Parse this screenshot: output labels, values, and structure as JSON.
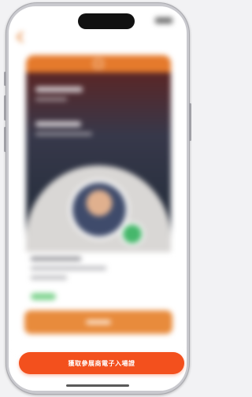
{
  "screen": {
    "primary_action": {
      "label": "獲取參展商電子入場證",
      "color": "#f3501d"
    },
    "accent_color": "#e57a2c",
    "content_state": "blurred"
  }
}
